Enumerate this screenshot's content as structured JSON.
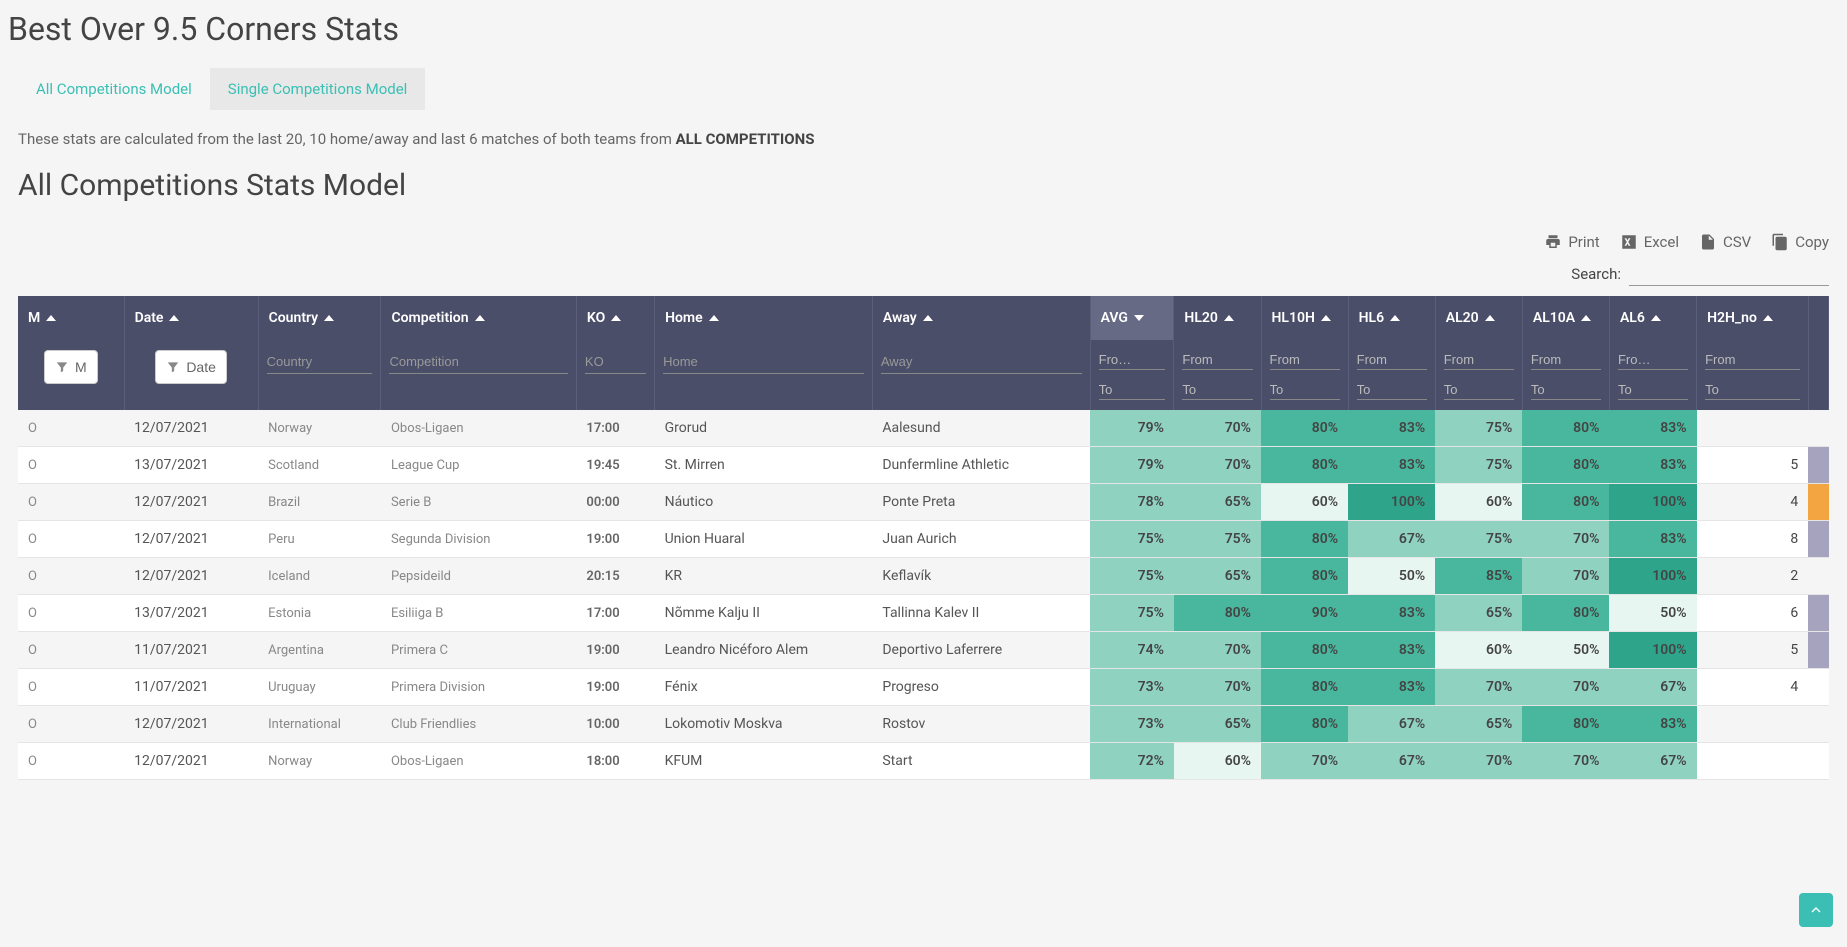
{
  "page_title": "Best Over 9.5 Corners Stats",
  "tabs": [
    {
      "label": "All Competitions Model",
      "active": true
    },
    {
      "label": "Single Competitions Model",
      "active": false
    }
  ],
  "description_prefix": "These stats are calculated from the last 20, 10 home/away and last 6 matches of both teams from ",
  "description_bold": "ALL COMPETITIONS",
  "subtitle": "All Competitions Stats Model",
  "toolbar": {
    "print": "Print",
    "excel": "Excel",
    "csv": "CSV",
    "copy": "Copy"
  },
  "search": {
    "label": "Search:",
    "value": ""
  },
  "columns": [
    {
      "key": "m",
      "label": "M",
      "sort": "asc"
    },
    {
      "key": "date",
      "label": "Date",
      "sort": "asc"
    },
    {
      "key": "country",
      "label": "Country",
      "sort": "asc"
    },
    {
      "key": "competition",
      "label": "Competition",
      "sort": "asc"
    },
    {
      "key": "ko",
      "label": "KO",
      "sort": "asc"
    },
    {
      "key": "home",
      "label": "Home",
      "sort": "asc"
    },
    {
      "key": "away",
      "label": "Away",
      "sort": "asc"
    },
    {
      "key": "avg",
      "label": "AVG",
      "sort": "desc"
    },
    {
      "key": "hl20",
      "label": "HL20",
      "sort": "asc"
    },
    {
      "key": "hl10h",
      "label": "HL10H",
      "sort": "asc"
    },
    {
      "key": "hl6",
      "label": "HL6",
      "sort": "asc"
    },
    {
      "key": "al20",
      "label": "AL20",
      "sort": "asc"
    },
    {
      "key": "al10a",
      "label": "AL10A",
      "sort": "asc"
    },
    {
      "key": "al6",
      "label": "AL6",
      "sort": "asc"
    },
    {
      "key": "h2h_no",
      "label": "H2H_no",
      "sort": "asc"
    }
  ],
  "filters": {
    "m_btn": "M",
    "date_btn": "Date",
    "country_ph": "Country",
    "competition_ph": "Competition",
    "ko_ph": "KO",
    "home_ph": "Home",
    "away_ph": "Away",
    "from_ph": "From",
    "from_ph_short": "Fro…",
    "to_ph": "To"
  },
  "rows": [
    {
      "m": "O",
      "date": "12/07/2021",
      "country": "Norway",
      "competition": "Obos-Ligaen",
      "ko": "17:00",
      "home": "Grorud",
      "away": "Aalesund",
      "avg": 79,
      "hl20": 70,
      "hl10h": 80,
      "hl6": 83,
      "al20": 75,
      "al10a": 80,
      "al6": 83,
      "h2h_no": "",
      "last_color": ""
    },
    {
      "m": "O",
      "date": "13/07/2021",
      "country": "Scotland",
      "competition": "League Cup",
      "ko": "19:45",
      "home": "St. Mirren",
      "away": "Dunfermline Athletic",
      "avg": 79,
      "hl20": 70,
      "hl10h": 80,
      "hl6": 83,
      "al20": 75,
      "al10a": 80,
      "al6": 83,
      "h2h_no": 5,
      "last_color": "#a6a3bf"
    },
    {
      "m": "O",
      "date": "12/07/2021",
      "country": "Brazil",
      "competition": "Serie B",
      "ko": "00:00",
      "home": "Náutico",
      "away": "Ponte Preta",
      "avg": 78,
      "hl20": 65,
      "hl10h": 60,
      "hl6": 100,
      "al20": 60,
      "al10a": 80,
      "al6": 100,
      "h2h_no": 4,
      "last_color": "#f2a541"
    },
    {
      "m": "O",
      "date": "12/07/2021",
      "country": "Peru",
      "competition": "Segunda Division",
      "ko": "19:00",
      "home": "Union Huaral",
      "away": "Juan Aurich",
      "avg": 75,
      "hl20": 75,
      "hl10h": 80,
      "hl6": 67,
      "al20": 75,
      "al10a": 70,
      "al6": 83,
      "h2h_no": 8,
      "last_color": "#a6a3bf"
    },
    {
      "m": "O",
      "date": "12/07/2021",
      "country": "Iceland",
      "competition": "Pepsideild",
      "ko": "20:15",
      "home": "KR",
      "away": "Keflavík",
      "avg": 75,
      "hl20": 65,
      "hl10h": 80,
      "hl6": 50,
      "al20": 85,
      "al10a": 70,
      "al6": 100,
      "h2h_no": 2,
      "last_color": ""
    },
    {
      "m": "O",
      "date": "13/07/2021",
      "country": "Estonia",
      "competition": "Esiliiga B",
      "ko": "17:00",
      "home": "Nõmme Kalju II",
      "away": "Tallinna Kalev II",
      "avg": 75,
      "hl20": 80,
      "hl10h": 90,
      "hl6": 83,
      "al20": 65,
      "al10a": 80,
      "al6": 50,
      "h2h_no": 6,
      "last_color": "#a6a3bf"
    },
    {
      "m": "O",
      "date": "11/07/2021",
      "country": "Argentina",
      "competition": "Primera C",
      "ko": "19:00",
      "home": "Leandro Nicéforo Alem",
      "away": "Deportivo Laferrere",
      "avg": 74,
      "hl20": 70,
      "hl10h": 80,
      "hl6": 83,
      "al20": 60,
      "al10a": 50,
      "al6": 100,
      "h2h_no": 5,
      "last_color": "#a6a3bf"
    },
    {
      "m": "O",
      "date": "11/07/2021",
      "country": "Uruguay",
      "competition": "Primera Division",
      "ko": "19:00",
      "home": "Fénix",
      "away": "Progreso",
      "avg": 73,
      "hl20": 70,
      "hl10h": 80,
      "hl6": 83,
      "al20": 70,
      "al10a": 70,
      "al6": 67,
      "h2h_no": 4,
      "last_color": ""
    },
    {
      "m": "O",
      "date": "12/07/2021",
      "country": "International",
      "competition": "Club Friendlies",
      "ko": "10:00",
      "home": "Lokomotiv Moskva",
      "away": "Rostov",
      "avg": 73,
      "hl20": 65,
      "hl10h": 80,
      "hl6": 67,
      "al20": 65,
      "al10a": 80,
      "al6": 83,
      "h2h_no": "",
      "last_color": ""
    },
    {
      "m": "O",
      "date": "12/07/2021",
      "country": "Norway",
      "competition": "Obos-Ligaen",
      "ko": "18:00",
      "home": "KFUM",
      "away": "Start",
      "avg": 72,
      "hl20": 60,
      "hl10h": 70,
      "hl6": 67,
      "al20": 70,
      "al10a": 70,
      "al6": 67,
      "h2h_no": "",
      "last_color": ""
    }
  ],
  "heatmap": {
    "low": "#e8f6f2",
    "mid": "#8fd2c0",
    "high": "#48b79d",
    "max": "#2ea58b"
  }
}
